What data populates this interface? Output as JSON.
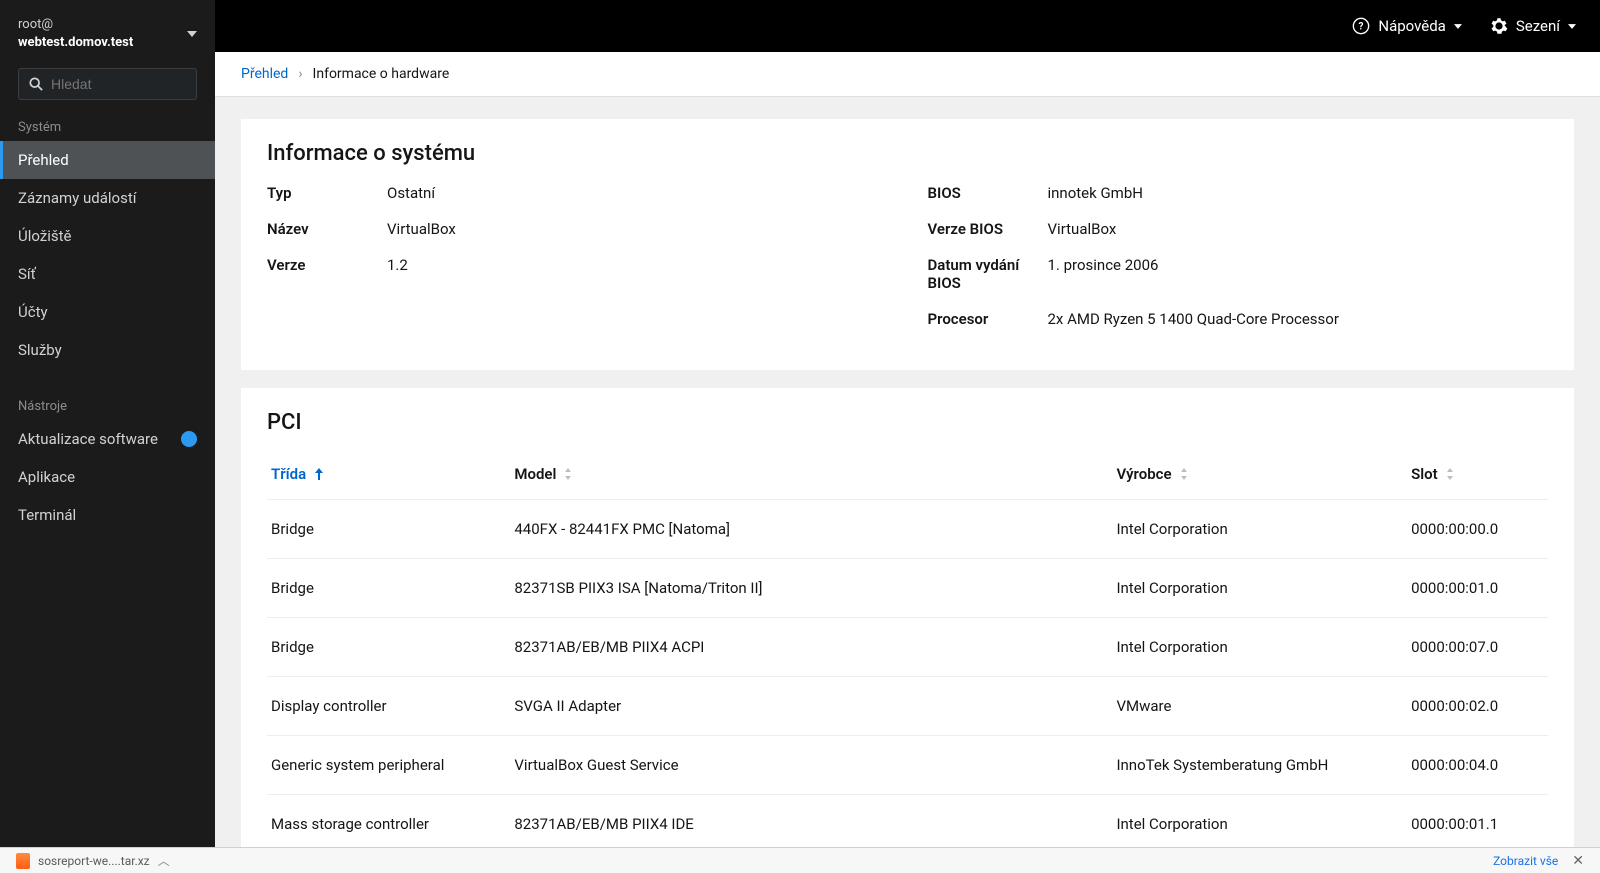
{
  "host": {
    "line1": "root@",
    "line2": "webtest.domov.test"
  },
  "search": {
    "placeholder": "Hledat"
  },
  "sections": {
    "system_label": "Systém",
    "tools_label": "Nástroje"
  },
  "nav": {
    "system": [
      {
        "label": "Přehled",
        "active": true
      },
      {
        "label": "Záznamy událostí"
      },
      {
        "label": "Úložiště"
      },
      {
        "label": "Síť"
      },
      {
        "label": "Účty"
      },
      {
        "label": "Služby"
      }
    ],
    "tools": [
      {
        "label": "Aktualizace software",
        "badge": "1"
      },
      {
        "label": "Aplikace"
      },
      {
        "label": "Terminál"
      }
    ]
  },
  "topbar": {
    "help": "Nápověda",
    "session": "Sezení"
  },
  "breadcrumb": {
    "root": "Přehled",
    "current": "Informace o hardware"
  },
  "sysinfo": {
    "title": "Informace o systému",
    "left": [
      {
        "label": "Typ",
        "value": "Ostatní"
      },
      {
        "label": "Název",
        "value": "VirtualBox"
      },
      {
        "label": "Verze",
        "value": "1.2"
      }
    ],
    "right": [
      {
        "label": "BIOS",
        "value": "innotek GmbH"
      },
      {
        "label": "Verze BIOS",
        "value": "VirtualBox"
      },
      {
        "label": "Datum vydání BIOS",
        "value": "1. prosince 2006"
      },
      {
        "label": "Procesor",
        "value": "2x AMD Ryzen 5 1400 Quad-Core Processor"
      }
    ]
  },
  "pci": {
    "title": "PCI",
    "headers": {
      "class": "Třída",
      "model": "Model",
      "vendor": "Výrobce",
      "slot": "Slot"
    },
    "sorted_by": "class",
    "rows": [
      {
        "class": "Bridge",
        "model": "440FX - 82441FX PMC [Natoma]",
        "vendor": "Intel Corporation",
        "slot": "0000:00:00.0"
      },
      {
        "class": "Bridge",
        "model": "82371SB PIIX3 ISA [Natoma/Triton II]",
        "vendor": "Intel Corporation",
        "slot": "0000:00:01.0"
      },
      {
        "class": "Bridge",
        "model": "82371AB/EB/MB PIIX4 ACPI",
        "vendor": "Intel Corporation",
        "slot": "0000:00:07.0"
      },
      {
        "class": "Display controller",
        "model": "SVGA II Adapter",
        "vendor": "VMware",
        "slot": "0000:00:02.0"
      },
      {
        "class": "Generic system peripheral",
        "model": "VirtualBox Guest Service",
        "vendor": "InnoTek Systemberatung GmbH",
        "slot": "0000:00:04.0"
      },
      {
        "class": "Mass storage controller",
        "model": "82371AB/EB/MB PIIX4 IDE",
        "vendor": "Intel Corporation",
        "slot": "0000:00:01.1"
      }
    ]
  },
  "downloads": {
    "file": "sosreport-we....tar.xz",
    "show_all": "Zobrazit vše"
  }
}
